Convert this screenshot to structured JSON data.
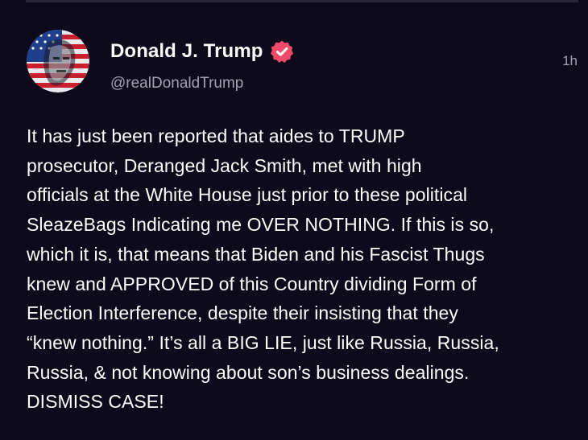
{
  "post": {
    "author": {
      "display_name": "Donald J. Trump",
      "handle": "@realDonaldTrump",
      "verified": true,
      "avatar_icon": "flag-portrait-avatar"
    },
    "timestamp": "1h",
    "body": "It has just been reported that aides to TRUMP\nprosecutor, Deranged Jack Smith, met with high\nofficials at the White House just prior to these political\nSleazeBags Indicating me OVER NOTHING. If this is so,\nwhich it is, that means that Biden and his Fascist Thugs\nknew and APPROVED of this Country dividing Form of\nElection Interference, despite their insisting that they\n“knew nothing.” It’s all a BIG LIE, just like Russia, Russia,\nRussia, & not knowing about son’s business dealings.\nDISMISS CASE!"
  },
  "colors": {
    "background": "#0d0a1b",
    "verified_badge": "#f04a6a",
    "secondary_text": "#a3a0ad"
  }
}
